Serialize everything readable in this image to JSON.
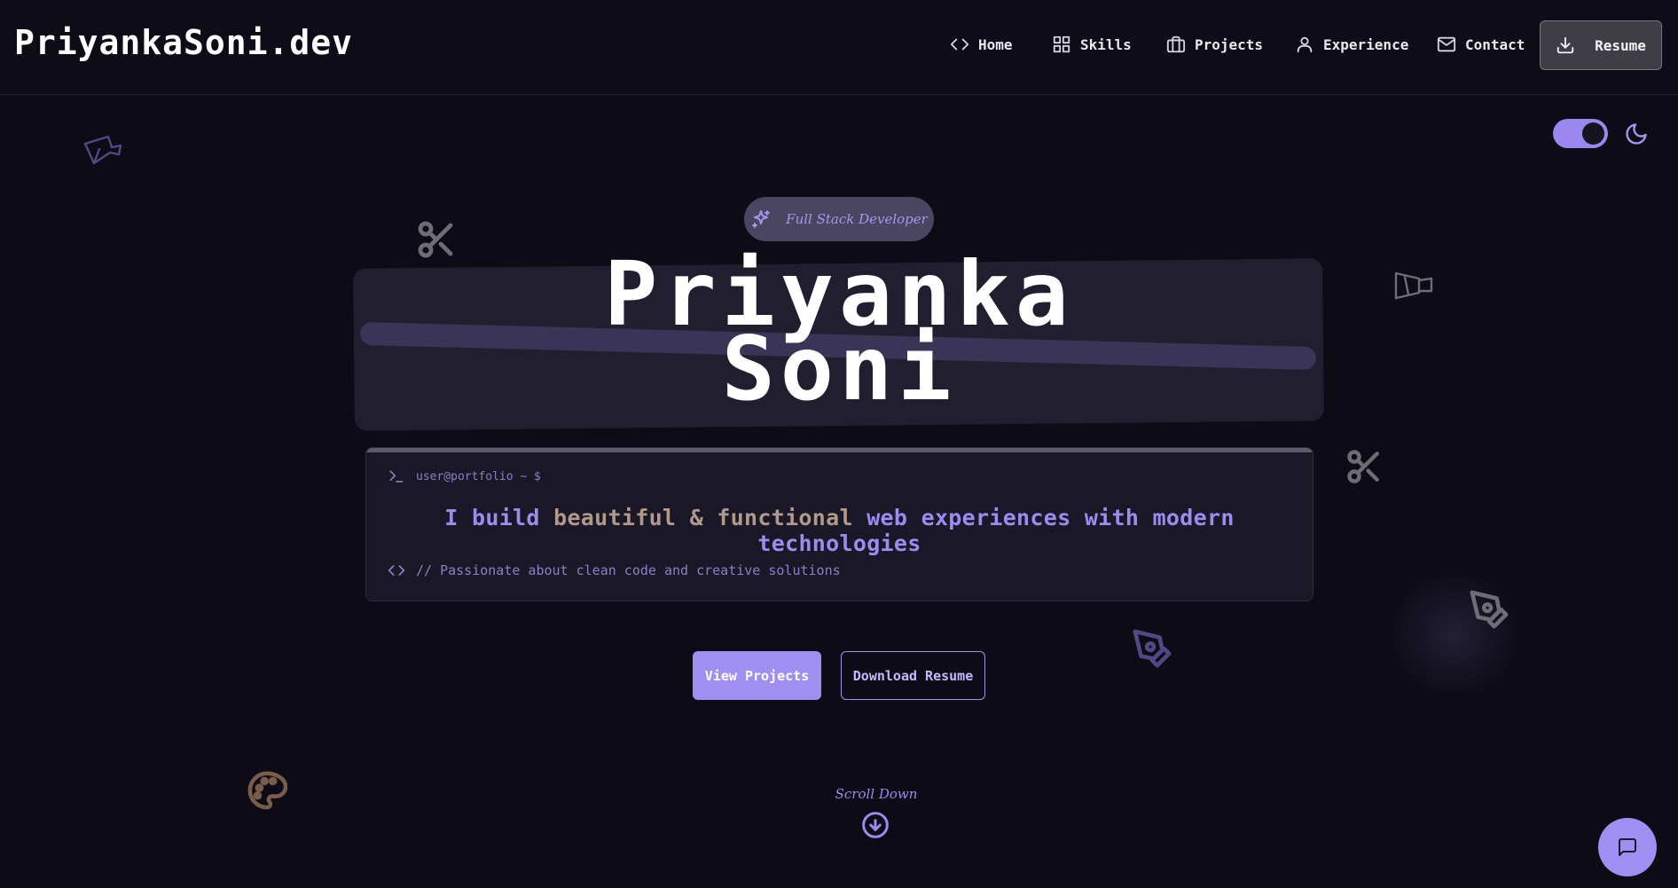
{
  "header": {
    "logo": "PriyankaSoni.dev",
    "nav": [
      {
        "label": "Home",
        "icon": "code-icon"
      },
      {
        "label": "Skills",
        "icon": "grid-icon"
      },
      {
        "label": "Projects",
        "icon": "briefcase-icon"
      },
      {
        "label": "Experience",
        "icon": "user-icon"
      },
      {
        "label": "Contact",
        "icon": "mail-icon"
      }
    ],
    "resume_label": "Resume"
  },
  "hero": {
    "badge": "Full Stack Developer",
    "name_line1": "Priyanka",
    "name_line2": "Soni",
    "terminal": {
      "prompt": "user@portfolio ~ $",
      "tagline_part1": "I build ",
      "tagline_part2": "beautiful & functional",
      "tagline_part3": " web experiences with modern technologies",
      "comment": "// Passionate about clean code and creative solutions"
    },
    "primary_button": "View Projects",
    "secondary_button": "Download Resume",
    "scroll_label": "Scroll Down"
  },
  "theme": {
    "mode": "dark",
    "toggle_on": true
  },
  "colors": {
    "background": "#0d0c16",
    "accent": "#a08ff2",
    "accent_text": "#9b8cf0",
    "banner": "#211e30"
  }
}
